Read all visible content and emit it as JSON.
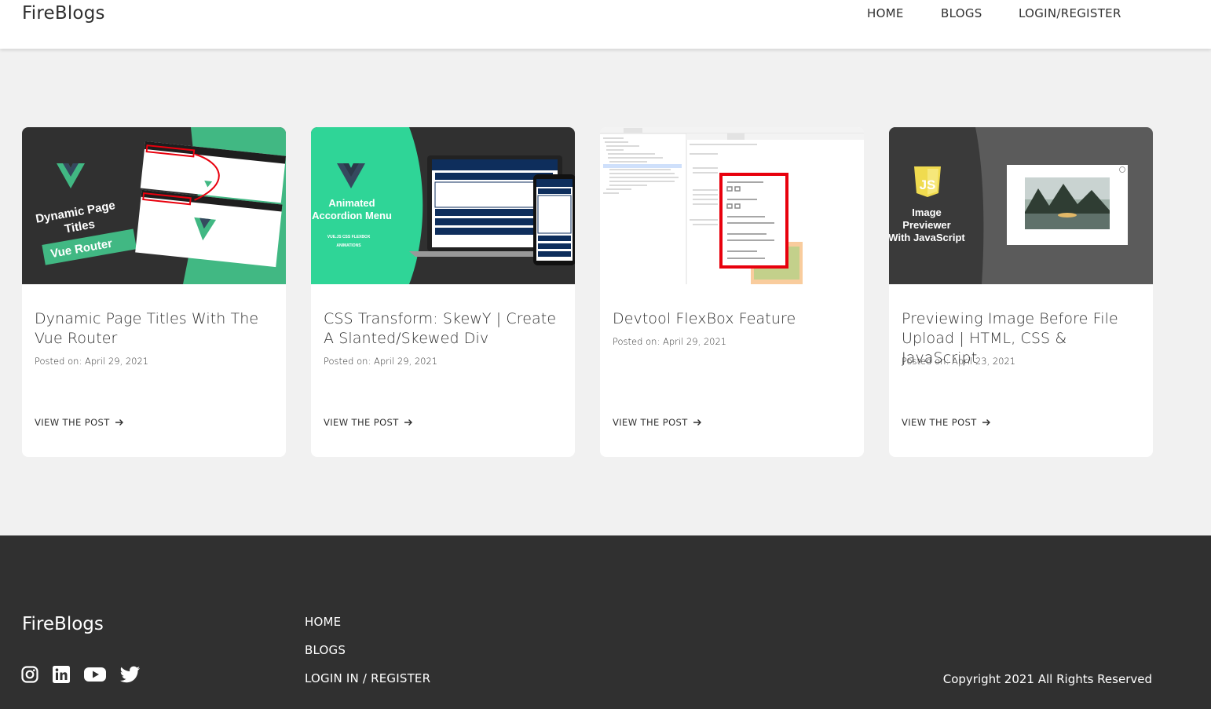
{
  "header": {
    "logo": "FireBlogs",
    "nav": [
      "HOME",
      "BLOGS",
      "LOGIN/REGISTER"
    ]
  },
  "cards": [
    {
      "title": "Dynamic Page Titles With The Vue Router",
      "date": "Posted on: April 29, 2021",
      "link": "VIEW THE POST",
      "thumb": {
        "line1": "Dynamic Page",
        "line2": "Titles",
        "badge": "Vue Router",
        "accent": "#41b883",
        "dark": "#35495e"
      }
    },
    {
      "title": "CSS Transform: SkewY | Create A Slanted/Skewed Div",
      "date": "Posted on: April 29, 2021",
      "link": "VIEW THE POST",
      "thumb": {
        "line1": "Animated",
        "line2": "Accordion Menu",
        "tags": "VUE.JS   CSS   FLEXBOX",
        "tags2": "ANIMATIONS",
        "accent": "#2fd597"
      }
    },
    {
      "title": "Devtool FlexBox Feature",
      "date": "Posted on: April 29, 2021",
      "link": "VIEW THE POST",
      "thumb": {
        "accent": "#e8000d"
      }
    },
    {
      "title": "Previewing Image Before File Upload | HTML, CSS & JavaScript",
      "date": "Posted on: April 23, 2021",
      "link": "VIEW THE POST",
      "thumb": {
        "js": "JS",
        "line1": "Image",
        "line2": "Previewer",
        "line3": "With JavaScript",
        "accent": "#f0db4f"
      }
    }
  ],
  "footer": {
    "logo": "FireBlogs",
    "links": [
      "HOME",
      "BLOGS",
      "LOGIN IN / REGISTER"
    ],
    "socials": [
      "instagram-icon",
      "linkedin-icon",
      "youtube-icon",
      "twitter-icon"
    ],
    "copyright": "Copyright 2021 All Rights Reserved"
  },
  "colors": {
    "dark": "#303030",
    "background": "#f1f1f1"
  }
}
